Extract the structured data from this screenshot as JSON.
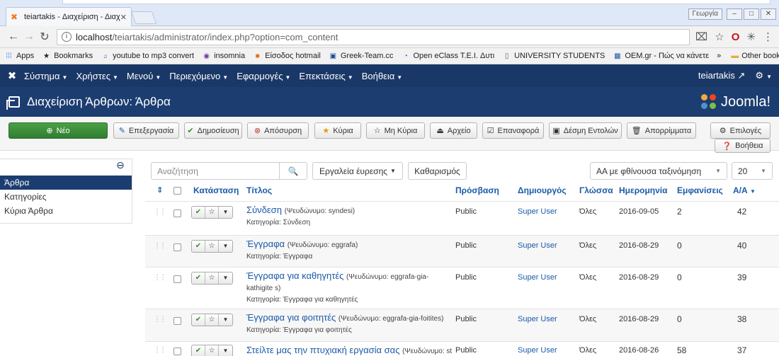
{
  "browser": {
    "tab_title": "teiartakis - Διαχείριση - Διαχ",
    "lang_button": "Γεωργία",
    "url_host": "localhost",
    "url_path": "/teiartakis/administrator/index.php?option=com_content",
    "bookmarks": [
      "Apps",
      "Bookmarks",
      "youtube to mp3 convert",
      "insomnia",
      "Είσοδος hotmail",
      "Greek-Team.cc",
      "Open eClass T.E.I. Δυτι",
      "UNIVERSITY STUDENTS",
      "OEM.gr - Πώς να κάνετε"
    ],
    "bookmarks_more": "»",
    "other_bookmarks": "Other bookmarks"
  },
  "navbar": {
    "menu": [
      "Σύστημα",
      "Χρήστες",
      "Μενού",
      "Περιεχόμενο",
      "Εφαρμογές",
      "Επεκτάσεις",
      "Βοήθεια"
    ],
    "site_link": "teiartakis"
  },
  "header": {
    "title": "Διαχείριση Άρθρων: Άρθρα",
    "brand": "Joomla!"
  },
  "toolbar": {
    "new": "Νέο",
    "edit": "Επεξεργασία",
    "publish": "Δημοσίευση",
    "unpublish": "Απόσυρση",
    "featured": "Κύρια",
    "unfeatured": "Μη Κύρια",
    "archive": "Αρχείο",
    "checkin": "Επαναφορά",
    "batch": "Δέσμη Εντολών",
    "trash": "Απορρίμματα",
    "options": "Επιλογές",
    "help": "Βοήθεια"
  },
  "sidebar": {
    "items": [
      "Άρθρα",
      "Κατηγορίες",
      "Κύρια Άρθρα"
    ]
  },
  "filters": {
    "search_placeholder": "Αναζήτηση",
    "search_tools": "Εργαλεία έυρεσης",
    "clear": "Καθαρισμός",
    "ordering": "ΑΑ με φθίνουσα ταξινόμηση",
    "limit": "20"
  },
  "table": {
    "headers": {
      "status": "Κατάσταση",
      "title": "Τίτλος",
      "access": "Πρόσβαση",
      "author": "Δημιουργός",
      "language": "Γλώσσα",
      "date": "Ημερομηνία",
      "hits": "Εμφανίσεις",
      "id": "Α/Α"
    },
    "rows": [
      {
        "title": "Σύνδεση",
        "alias": "(Ψευδώνυμο: syndesi)",
        "category": "Κατηγορία: Σύνδεση",
        "access": "Public",
        "author": "Super User",
        "language": "Όλες",
        "date": "2016-09-05",
        "hits": "2",
        "id": "42"
      },
      {
        "title": "Έγγραφα",
        "alias": "(Ψευδώνυμο: eggrafa)",
        "category": "Κατηγορία: Έγγραφα",
        "access": "Public",
        "author": "Super User",
        "language": "Όλες",
        "date": "2016-08-29",
        "hits": "0",
        "id": "40"
      },
      {
        "title": "Έγγραφα για καθηγητές",
        "alias": "(Ψευδώνυμο: eggrafa-gia-kathigite s)",
        "category": "Κατηγορία: Έγγραφα για καθηγητές",
        "access": "Public",
        "author": "Super User",
        "language": "Όλες",
        "date": "2016-08-29",
        "hits": "0",
        "id": "39"
      },
      {
        "title": "Έγγραφα για φοιτητές",
        "alias": "(Ψευδώνυμο: eggrafa-gia-foitites)",
        "category": "Κατηγορία: Έγγραφα για φοιτητές",
        "access": "Public",
        "author": "Super User",
        "language": "Όλες",
        "date": "2016-08-29",
        "hits": "0",
        "id": "38"
      },
      {
        "title": "Στείλτε μας την πτυχιακή εργασία σας",
        "alias": "(Ψευδώνυμο: steilt",
        "category": "",
        "access": "Public",
        "author": "Super User",
        "language": "Όλες",
        "date": "2016-08-26",
        "hits": "58",
        "id": "37"
      }
    ]
  }
}
